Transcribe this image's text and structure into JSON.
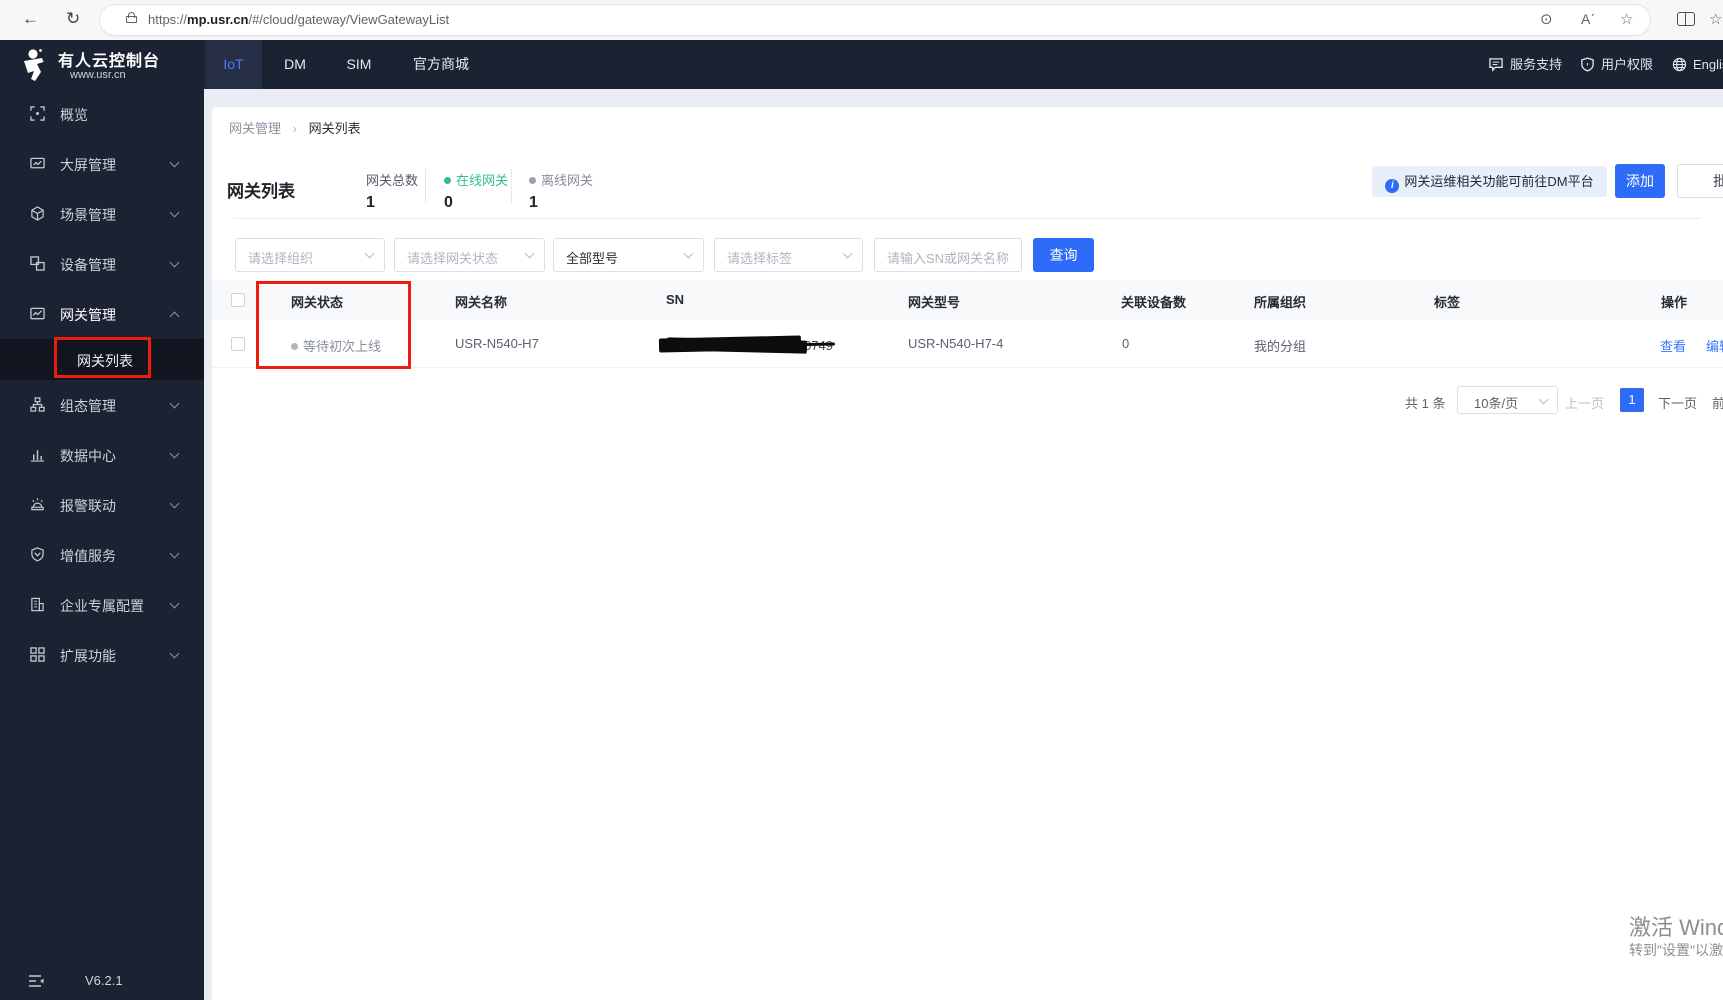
{
  "colors": {
    "accent_blue": "#2e6bf6",
    "online_green": "#2fbe8f",
    "offline_gray": "#9aa1ac",
    "annotation_red": "#ee1c0c",
    "sidebar_bg": "#1b2231"
  },
  "browser": {
    "url_scheme": "https://",
    "url_host": "mp.usr.cn",
    "url_path": "/#/cloud/gateway/ViewGatewayList"
  },
  "topnav": {
    "brand_title": "有人云控制台",
    "brand_subtitle": "www.usr.cn",
    "tabs": [
      {
        "label": "IoT",
        "active": true
      },
      {
        "label": "DM",
        "active": false
      },
      {
        "label": "SIM",
        "active": false
      },
      {
        "label": "官方商城",
        "active": false
      }
    ],
    "right": {
      "support": "服务支持",
      "permission": "用户权限",
      "language": "English"
    }
  },
  "sidebar": {
    "items": [
      {
        "label": "概览",
        "icon": "overview",
        "expandable": false,
        "expanded": false,
        "active": false
      },
      {
        "label": "大屏管理",
        "icon": "screen",
        "expandable": true,
        "expanded": false,
        "active": false
      },
      {
        "label": "场景管理",
        "icon": "scene",
        "expandable": true,
        "expanded": false,
        "active": false
      },
      {
        "label": "设备管理",
        "icon": "device",
        "expandable": true,
        "expanded": false,
        "active": false
      },
      {
        "label": "网关管理",
        "icon": "gateway",
        "expandable": true,
        "expanded": true,
        "active": true,
        "children": [
          {
            "label": "网关列表",
            "active": true
          }
        ]
      },
      {
        "label": "组态管理",
        "icon": "topology",
        "expandable": true,
        "expanded": false,
        "active": false
      },
      {
        "label": "数据中心",
        "icon": "data",
        "expandable": true,
        "expanded": false,
        "active": false
      },
      {
        "label": "报警联动",
        "icon": "alarm",
        "expandable": true,
        "expanded": false,
        "active": false
      },
      {
        "label": "增值服务",
        "icon": "vas",
        "expandable": true,
        "expanded": false,
        "active": false
      },
      {
        "label": "企业专属配置",
        "icon": "enterprise",
        "expandable": true,
        "expanded": false,
        "active": false
      },
      {
        "label": "扩展功能",
        "icon": "extension",
        "expandable": true,
        "expanded": false,
        "active": false
      }
    ],
    "version": "V6.2.1"
  },
  "breadcrumb": {
    "parent": "网关管理",
    "current": "网关列表"
  },
  "page": {
    "title": "网关列表",
    "stats": [
      {
        "label": "网关总数",
        "value": "1",
        "kind": "total"
      },
      {
        "label": "在线网关",
        "value": "0",
        "kind": "online"
      },
      {
        "label": "离线网关",
        "value": "1",
        "kind": "offline"
      }
    ],
    "notice": "网关运维相关功能可前往DM平台",
    "add_button": "添加",
    "batch_button": "批量",
    "query_button": "查询"
  },
  "filters": [
    {
      "type": "select",
      "text": "请选择组织",
      "is_placeholder": true
    },
    {
      "type": "select",
      "text": "请选择网关状态",
      "is_placeholder": true
    },
    {
      "type": "select",
      "text": "全部型号",
      "is_placeholder": false
    },
    {
      "type": "select",
      "text": "请选择标签",
      "is_placeholder": true
    },
    {
      "type": "input",
      "text": "请输入SN或网关名称",
      "is_placeholder": true
    }
  ],
  "table": {
    "columns": [
      "网关状态",
      "网关名称",
      "SN",
      "网关型号",
      "关联设备数",
      "所属组织",
      "标签",
      "操作"
    ],
    "row": {
      "status": "等待初次上线",
      "name": "USR-N540-H7",
      "sn_redacted": true,
      "sn_visible_tail": "0749",
      "model": "USR-N540-H7-4",
      "device_count": "0",
      "organization": "我的分组",
      "tags": "",
      "action_view": "查看",
      "action_edit": "编辑"
    }
  },
  "pagination": {
    "total": "共 1 条",
    "page_size": "10条/页",
    "prev": "上一页",
    "page": "1",
    "next": "下一页",
    "jump": "前往"
  },
  "watermark": {
    "line1": "激活 Windows",
    "line2": "转到\"设置\"以激活 Windows。"
  }
}
